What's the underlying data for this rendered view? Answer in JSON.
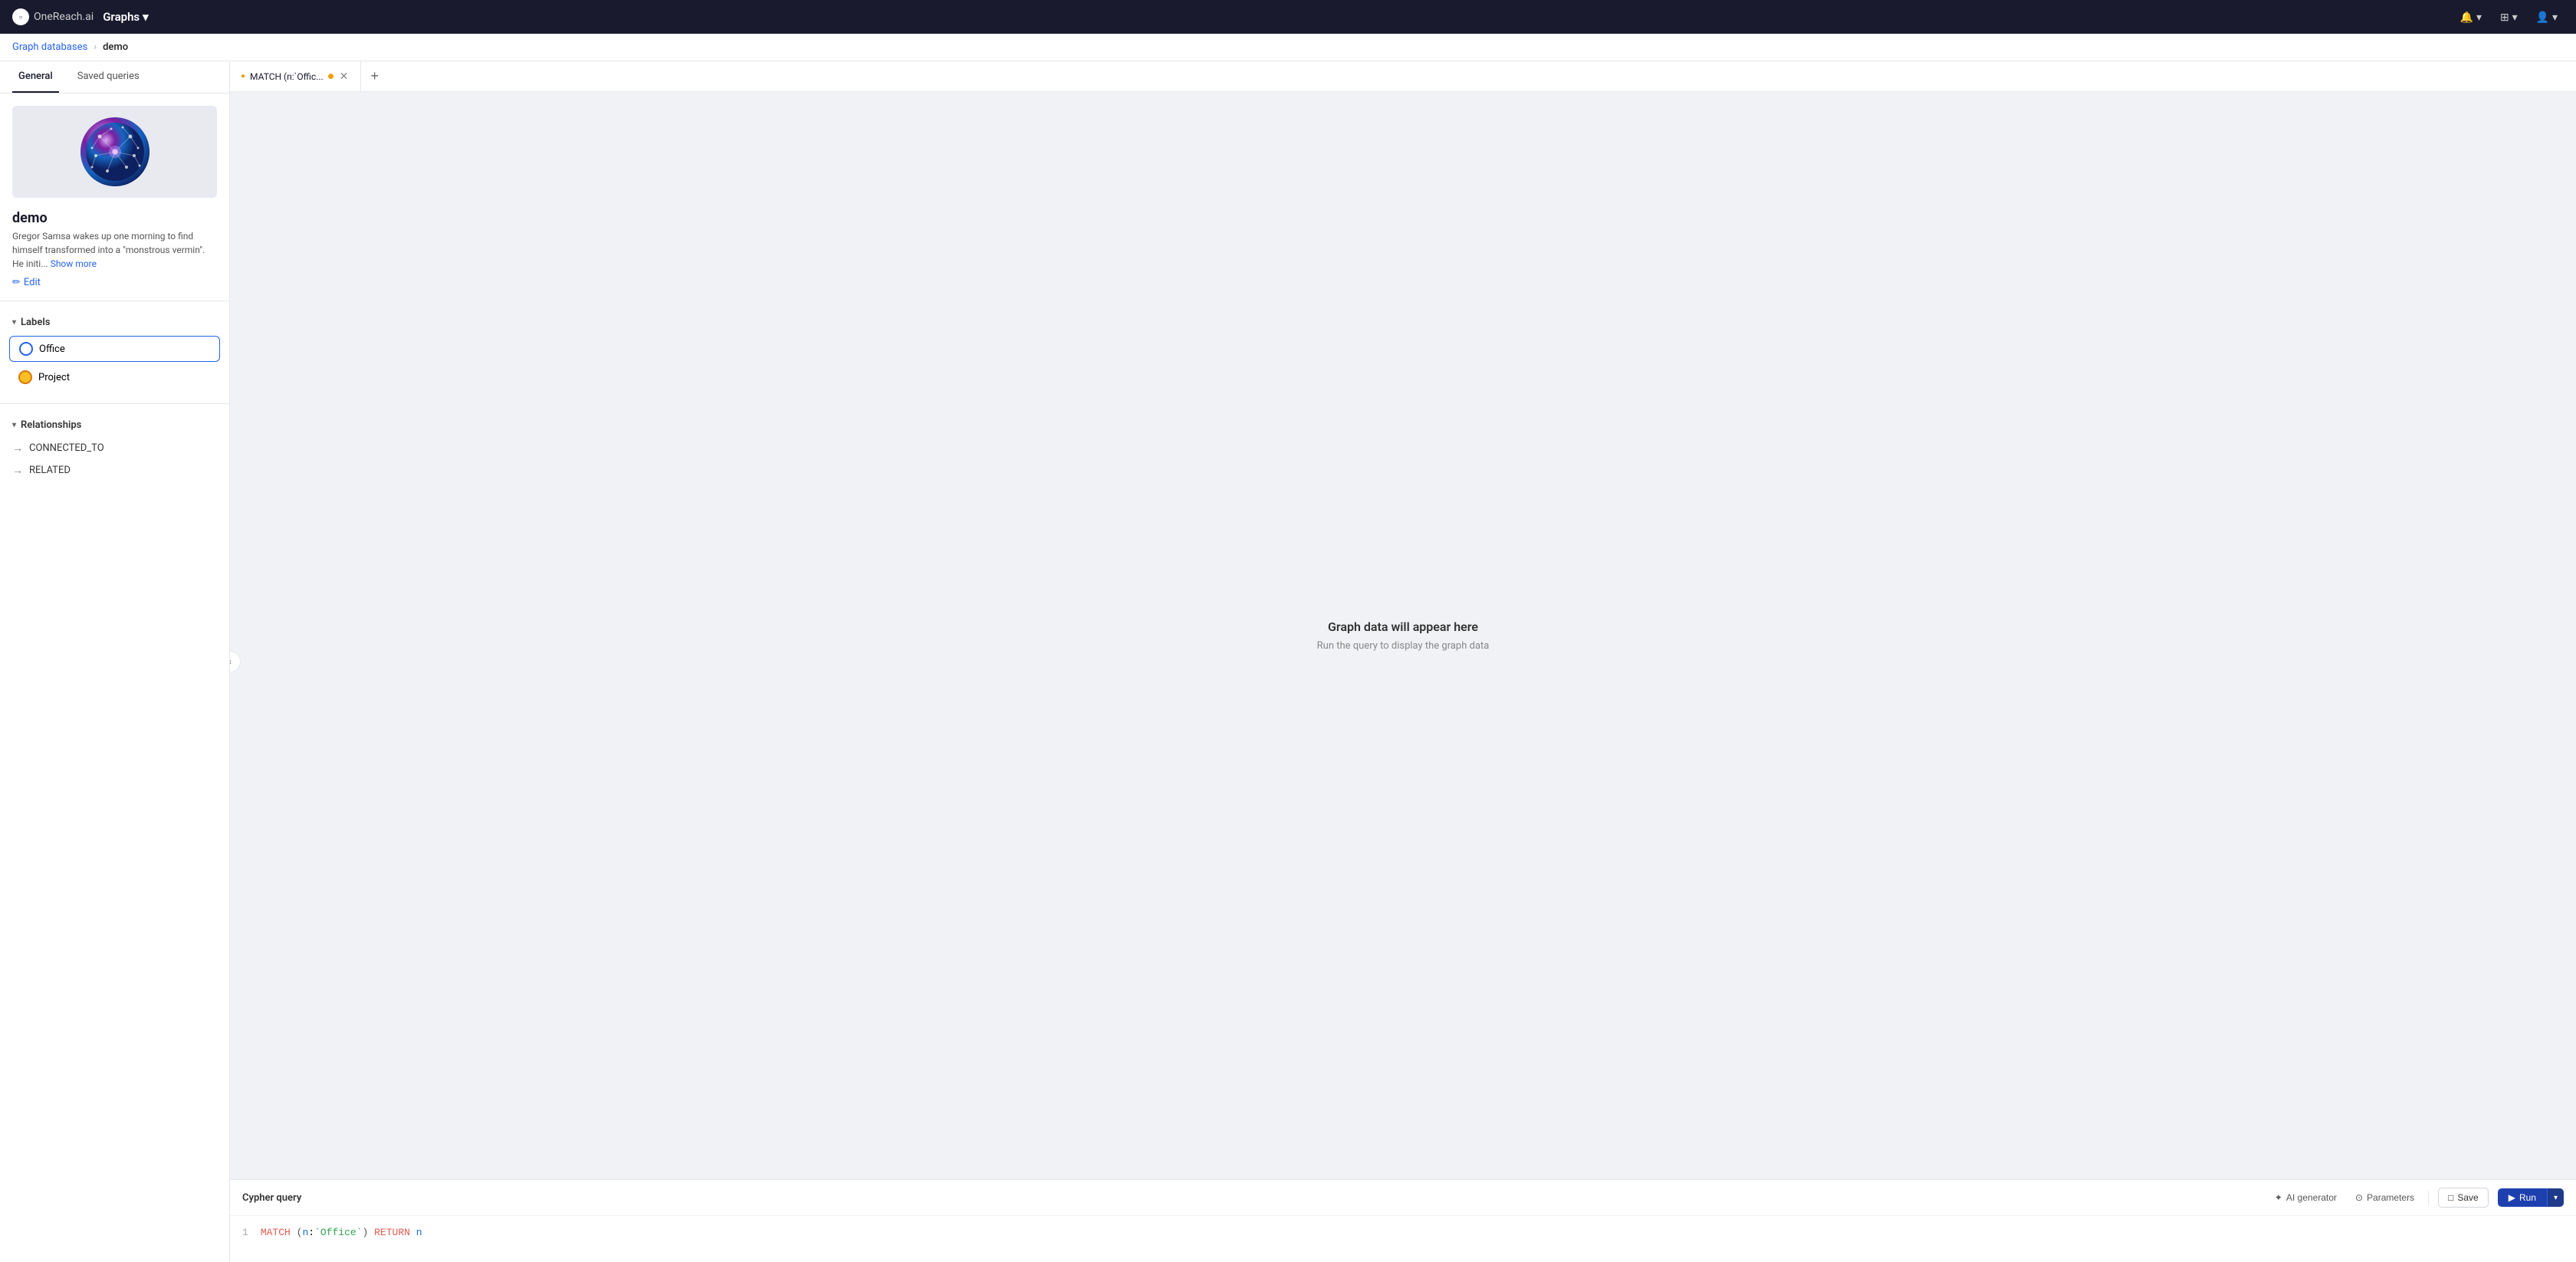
{
  "brand": {
    "logo_text": "○",
    "name": "OneReach.ai"
  },
  "nav": {
    "title": "Graphs",
    "chevron": "▾",
    "icons": [
      "🔔",
      "⊞",
      "👤"
    ]
  },
  "breadcrumb": {
    "parent": "Graph databases",
    "separator": "›",
    "current": "demo"
  },
  "sidebar": {
    "tabs": [
      {
        "label": "General",
        "active": true
      },
      {
        "label": "Saved queries",
        "active": false
      }
    ],
    "db_name": "demo",
    "db_description_short": "Gregor Samsa wakes up one morning to find himself transformed into a \"monstrous vermin\". He initi...",
    "show_more_label": "Show more",
    "edit_label": "Edit",
    "labels_section": {
      "title": "Labels",
      "items": [
        {
          "label": "Office",
          "active": true,
          "color": "blue"
        },
        {
          "label": "Project",
          "active": false,
          "color": "yellow"
        }
      ]
    },
    "relationships_section": {
      "title": "Relationships",
      "items": [
        {
          "label": "CONNECTED_TO"
        },
        {
          "label": "RELATED"
        }
      ]
    }
  },
  "query_tabs": [
    {
      "label": "MATCH (n:`Offic...",
      "active": true,
      "has_dot": true
    }
  ],
  "add_tab_label": "+",
  "collapse_icon": "‹",
  "graph": {
    "empty_title": "Graph data will appear here",
    "empty_subtitle": "Run the query to display the graph data"
  },
  "cypher": {
    "title": "Cypher query",
    "ai_generator_label": "AI generator",
    "parameters_label": "Parameters",
    "save_label": "Save",
    "run_label": "Run",
    "run_arrow": "▾",
    "line_number": "1",
    "query_match": "MATCH",
    "query_node_open": "(",
    "query_var": "n",
    "query_colon": ":",
    "query_label": "`Office`",
    "query_node_close": ")",
    "query_return": "RETURN",
    "query_var2": "n"
  }
}
